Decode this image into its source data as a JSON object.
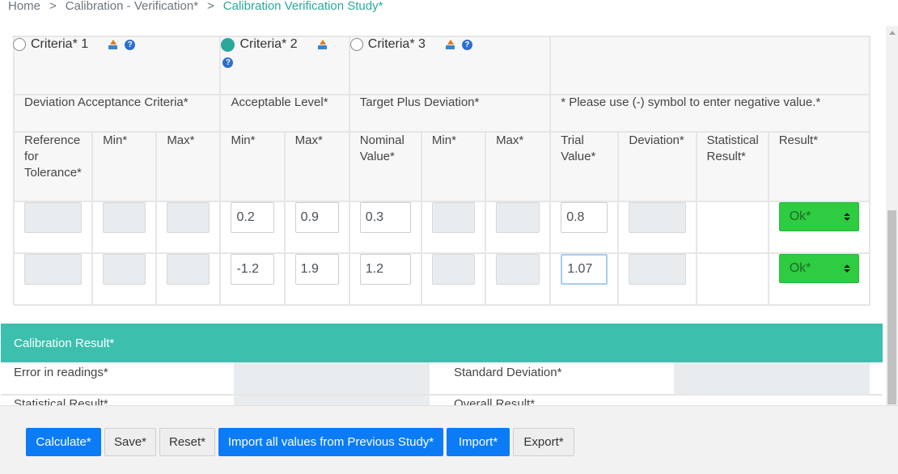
{
  "breadcrumb": [
    "Home",
    "Calibration - Verification*",
    "Calibration Verification Study*"
  ],
  "criteria": [
    {
      "label": "Criteria* 1",
      "selected": false
    },
    {
      "label": "Criteria* 2",
      "selected": true
    },
    {
      "label": "Criteria* 3",
      "selected": false
    }
  ],
  "icons": {
    "upload": "upload-icon",
    "help": "help-icon",
    "help_glyph": "?"
  },
  "group_headers": {
    "deviation": "Deviation Acceptance Criteria*",
    "acceptable": "Acceptable Level*",
    "target": "Target Plus Deviation*",
    "warning": "* Please use (-) symbol to enter negative value.*"
  },
  "columns": [
    "Reference for Tolerance*",
    "Min*",
    "Max*",
    "Min*",
    "Max*",
    "Nominal Value*",
    "Min*",
    "Max*",
    "Trial Value*",
    "Deviation*",
    "Statistical Result*",
    "Result*"
  ],
  "rows": [
    {
      "acc_min": "0.2",
      "acc_max": "0.9",
      "nominal": "0.3",
      "trial": "0.8",
      "result": "Ok*"
    },
    {
      "acc_min": "-1.2",
      "acc_max": "1.9",
      "nominal": "1.2",
      "trial": "1.07",
      "result": "Ok*"
    }
  ],
  "calibration_result": {
    "title": "Calibration Result*",
    "error_label": "Error in readings*",
    "std_dev_label": "Standard Deviation*",
    "stat_label": "Statistical Result*",
    "overall_label": "Overall Result*"
  },
  "buttons": {
    "calculate": "Calculate*",
    "save": "Save*",
    "reset": "Reset*",
    "import_prev": "Import all values from Previous Study*",
    "import": "Import*",
    "export": "Export*"
  },
  "colors": {
    "accent": "#3dbfae",
    "primary": "#0b7cf5",
    "ok": "#2ecc40",
    "warning": "#e0232e"
  }
}
